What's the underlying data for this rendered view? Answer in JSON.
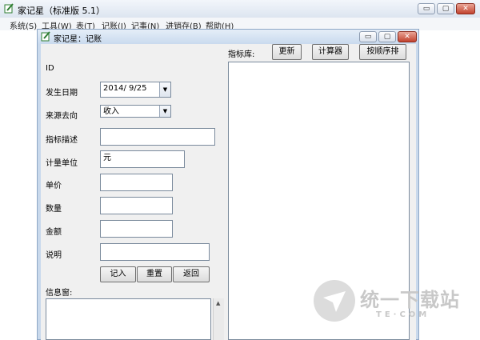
{
  "outer_window": {
    "title": "家记星（标准版 5.1）",
    "menu": [
      "系统(S)",
      "工具(W)",
      "表(T)",
      "记账(J)",
      "记事(N)",
      "进销存(B)",
      "帮助(H)"
    ]
  },
  "window_controls": {
    "minimize": "▭",
    "maximize": "▢",
    "close": "✕"
  },
  "inner_window": {
    "title": "家记星：记账"
  },
  "form": {
    "id_label": "ID",
    "date_label": "发生日期",
    "date_value": "2014/ 9/25",
    "source_label": "来源去向",
    "source_value": "收入",
    "indicator_desc_label": "指标描述",
    "unit_label": "计量单位",
    "unit_value": "元",
    "price_label": "单价",
    "quantity_label": "数量",
    "amount_label": "金额",
    "note_label": "说明",
    "info_label": "信息窗:"
  },
  "buttons": {
    "record": "记入",
    "reset": "重置",
    "back": "返回",
    "refresh": "更新",
    "calculator": "计算器",
    "sort": "按顺序排"
  },
  "library": {
    "label": "指标库:"
  },
  "watermark": {
    "text": "统一下载站",
    "sub": "TE·COM"
  }
}
